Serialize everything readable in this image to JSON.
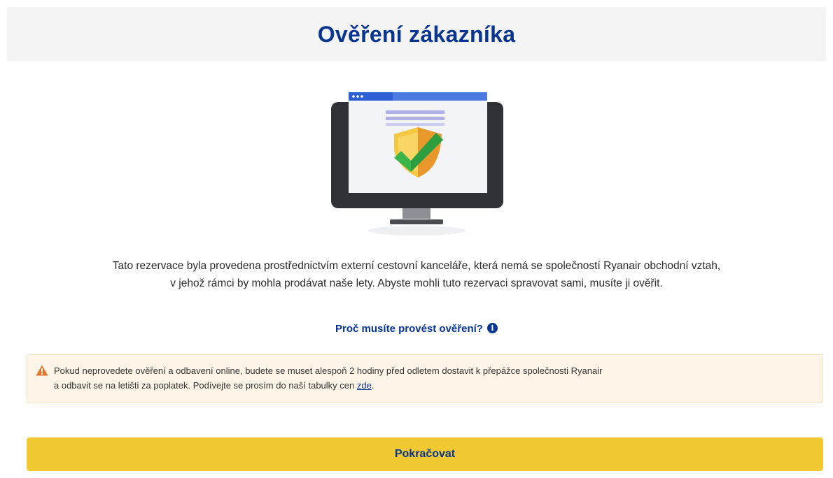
{
  "header": {
    "title": "Ověření zákazníka"
  },
  "illustration": {
    "icon": "monitor-shield-check-icon"
  },
  "description": {
    "line1": "Tato rezervace byla provedena prostřednictvím externí cestovní kanceláře, která nemá se společností Ryanair obchodní vztah,",
    "line2": "v jehož rámci by mohla prodávat naše lety. Abyste mohli tuto rezervaci spravovat sami, musíte ji ověřit."
  },
  "why_link": {
    "label": "Proč musíte provést ověření?",
    "icon": "info-icon",
    "icon_glyph": "i"
  },
  "warning": {
    "icon": "warning-triangle-icon",
    "line1": "Pokud neprovedete ověření a odbavení online, budete se muset alespoň 2 hodiny před odletem dostavit k přepážce společnosti Ryanair",
    "line2_prefix": "a odbavit se na letišti za poplatek. Podívejte se prosím do naší tabulky cen ",
    "link_label": "zde",
    "line2_suffix": "."
  },
  "continue_button": {
    "label": "Pokračovat"
  },
  "colors": {
    "brand_blue": "#073590",
    "button_yellow": "#f1c933",
    "warning_bg": "#fef5e8",
    "warning_orange": "#e8742a",
    "check_green": "#3bb54a"
  }
}
